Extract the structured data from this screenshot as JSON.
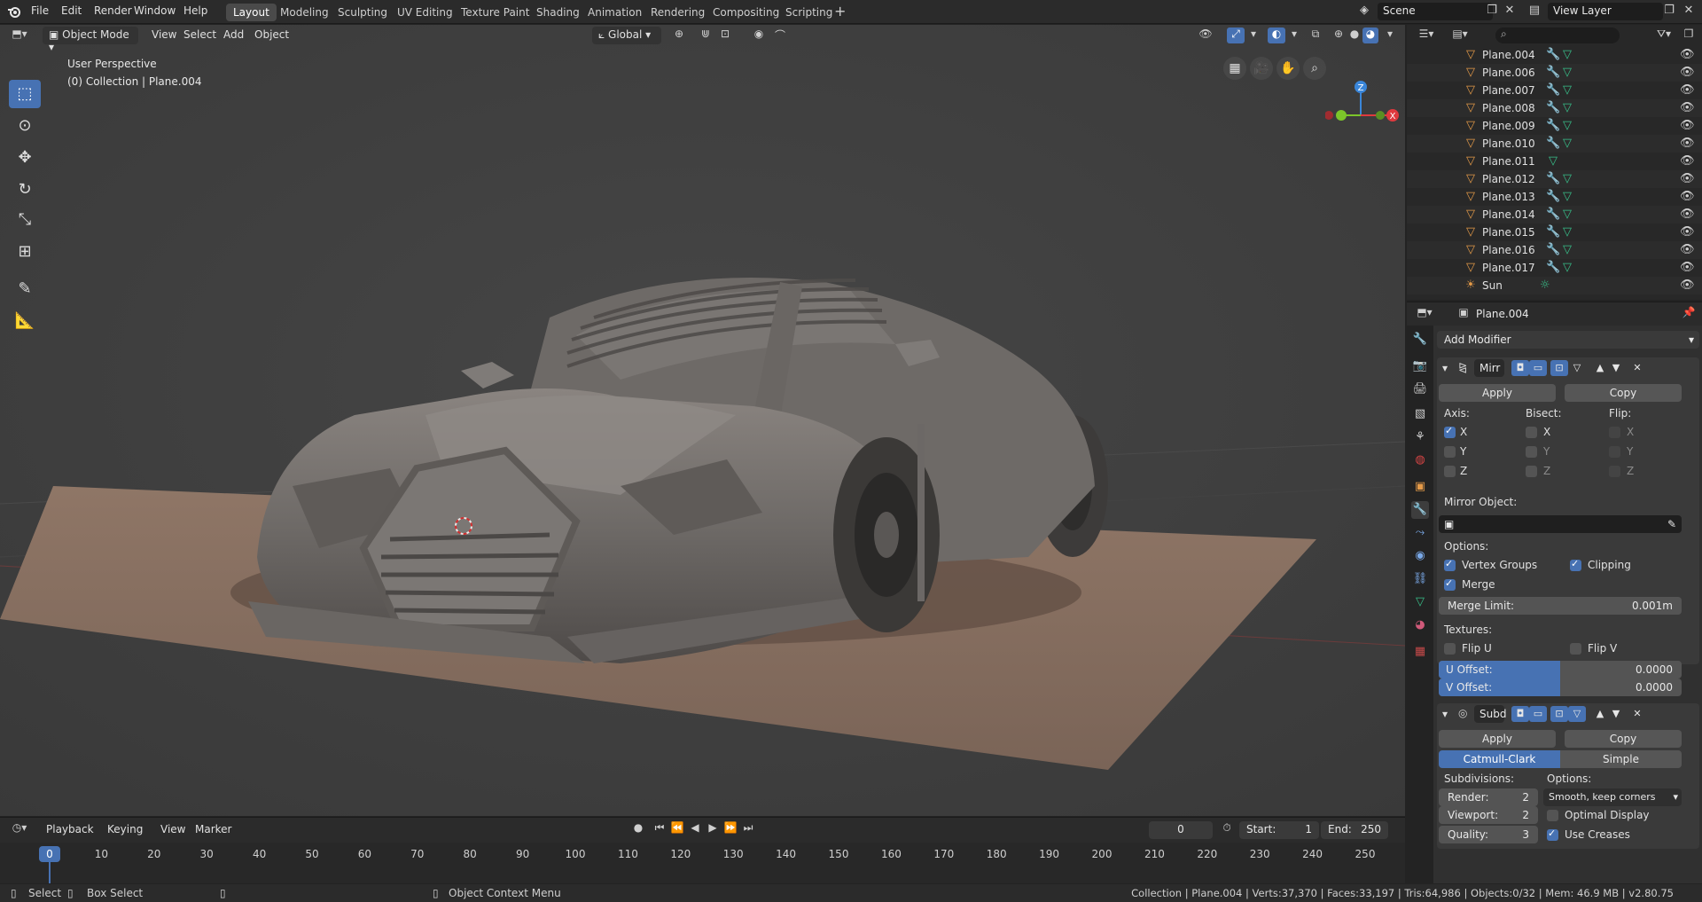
{
  "topbar": {
    "menus": [
      "File",
      "Edit",
      "Render",
      "Window",
      "Help"
    ],
    "workspaces": [
      "Layout",
      "Modeling",
      "Sculpting",
      "UV Editing",
      "Texture Paint",
      "Shading",
      "Animation",
      "Rendering",
      "Compositing",
      "Scripting"
    ],
    "active_workspace": "Layout",
    "add_tab": "+",
    "scene": "Scene",
    "view_layer": "View Layer"
  },
  "viewport": {
    "mode": "Object Mode",
    "menus": [
      "View",
      "Select",
      "Add",
      "Object"
    ],
    "orientation": "Global",
    "perspective_label": "User Perspective",
    "collection_label": "(0) Collection | Plane.004",
    "gizmo_axes": {
      "x": "X",
      "y": "Y",
      "z": "Z"
    }
  },
  "timeline": {
    "menus": [
      "Playback",
      "Keying",
      "View",
      "Marker"
    ],
    "current_frame": "0",
    "start_label": "Start:",
    "start": "1",
    "end_label": "End:",
    "end": "250",
    "ticks": [
      "0",
      "10",
      "20",
      "30",
      "40",
      "50",
      "60",
      "70",
      "80",
      "90",
      "100",
      "110",
      "120",
      "130",
      "140",
      "150",
      "160",
      "170",
      "180",
      "190",
      "200",
      "210",
      "220",
      "230",
      "240",
      "250"
    ]
  },
  "statusbar": {
    "select": "Select",
    "box_select": "Box Select",
    "context_menu": "Object Context Menu",
    "stats": "Collection | Plane.004 | Verts:37,370 | Faces:33,197 | Tris:64,986 | Objects:0/32 | Mem: 46.9 MB | v2.80.75"
  },
  "outliner": {
    "rows": [
      {
        "name": "Plane.004",
        "modifier": true
      },
      {
        "name": "Plane.006",
        "modifier": true
      },
      {
        "name": "Plane.007",
        "modifier": true
      },
      {
        "name": "Plane.008",
        "modifier": true
      },
      {
        "name": "Plane.009",
        "modifier": true
      },
      {
        "name": "Plane.010",
        "modifier": true
      },
      {
        "name": "Plane.011",
        "modifier": false
      },
      {
        "name": "Plane.012",
        "modifier": true
      },
      {
        "name": "Plane.013",
        "modifier": true
      },
      {
        "name": "Plane.014",
        "modifier": true
      },
      {
        "name": "Plane.015",
        "modifier": true
      },
      {
        "name": "Plane.016",
        "modifier": true
      },
      {
        "name": "Plane.017",
        "modifier": true
      },
      {
        "name": "Sun",
        "modifier": false
      }
    ]
  },
  "properties": {
    "object_name": "Plane.004",
    "add_modifier": "Add Modifier",
    "mirror": {
      "name": "Mirr",
      "apply": "Apply",
      "copy": "Copy",
      "axis_label": "Axis:",
      "bisect_label": "Bisect:",
      "flip_label": "Flip:",
      "x": "X",
      "y": "Y",
      "z": "Z",
      "mirror_object_label": "Mirror Object:",
      "options_label": "Options:",
      "vertex_groups": "Vertex Groups",
      "clipping": "Clipping",
      "merge": "Merge",
      "merge_limit_label": "Merge Limit:",
      "merge_limit": "0.001m",
      "textures_label": "Textures:",
      "flip_u": "Flip U",
      "flip_v": "Flip V",
      "u_offset_label": "U Offset:",
      "u_offset": "0.0000",
      "v_offset_label": "V Offset:",
      "v_offset": "0.0000"
    },
    "subdivision": {
      "name": "Subd",
      "apply": "Apply",
      "copy": "Copy",
      "catmull": "Catmull-Clark",
      "simple": "Simple",
      "subdivisions_label": "Subdivisions:",
      "options_label": "Options:",
      "render_label": "Render:",
      "render": "2",
      "viewport_label": "Viewport:",
      "viewport": "2",
      "quality_label": "Quality:",
      "quality": "3",
      "uv_smooth": "Smooth, keep corners",
      "optimal_display": "Optimal Display",
      "use_creases": "Use Creases"
    }
  },
  "colors": {
    "accent": "#4772b3",
    "object_orange": "#e49a48",
    "mesh_green": "#38c08a",
    "axis_x": "#e0393e",
    "axis_y": "#7cc52a",
    "axis_z": "#3a86d9"
  }
}
